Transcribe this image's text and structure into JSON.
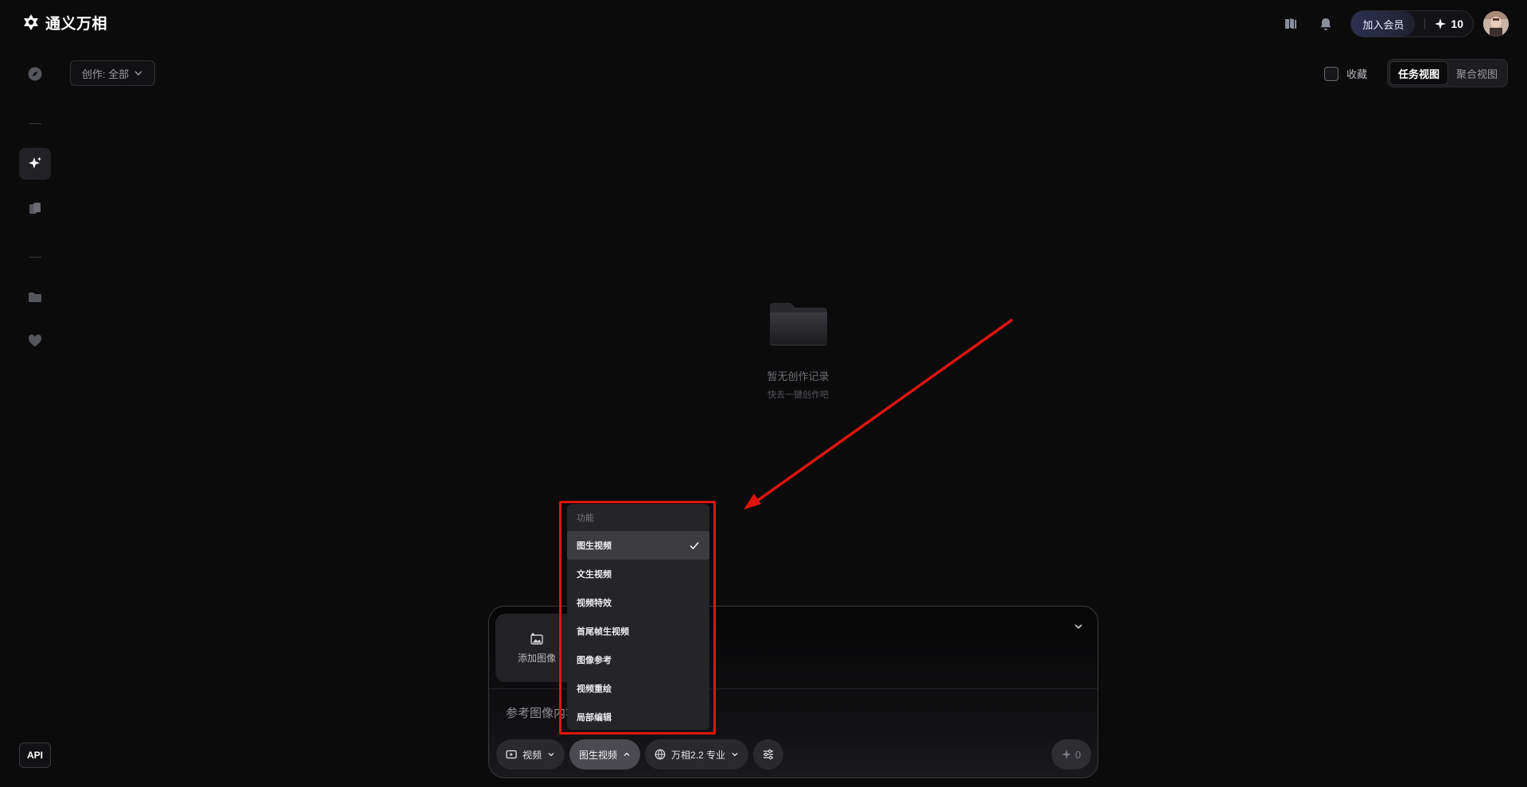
{
  "app": {
    "name": "通义万相"
  },
  "header": {
    "icons": [
      "docs-icon",
      "bell-icon"
    ],
    "member_button": "加入会员",
    "credits": "10"
  },
  "sidebar": {
    "items": [
      {
        "name": "explore",
        "icon": "compass-icon"
      },
      {
        "name": "create",
        "icon": "sparkle-icon",
        "active": true
      },
      {
        "name": "gallery",
        "icon": "stack-icon"
      },
      {
        "name": "folder",
        "icon": "folder-icon"
      },
      {
        "name": "favorites",
        "icon": "heart-icon"
      }
    ],
    "api_label": "API"
  },
  "filter": {
    "label": "创作: 全部"
  },
  "favorites": {
    "label": "收藏",
    "checked": false
  },
  "view_toggle": {
    "tabs": [
      {
        "label": "任务视图",
        "active": true
      },
      {
        "label": "聚合视图",
        "active": false
      }
    ]
  },
  "empty_state": {
    "title": "暂无创作记录",
    "subtitle": "快去一键创作吧"
  },
  "composer": {
    "add_image": "添加图像",
    "placeholder": "参考图像内容",
    "chips": {
      "type": "视频",
      "mode": "图生视频",
      "model": "万相2.2 专业"
    },
    "send_count": "0"
  },
  "dropdown": {
    "section": "功能",
    "items": [
      {
        "label": "图生视频",
        "selected": true
      },
      {
        "label": "文生视频",
        "selected": false
      },
      {
        "label": "视频特效",
        "selected": false
      },
      {
        "label": "首尾帧生视频",
        "selected": false
      },
      {
        "label": "图像参考",
        "selected": false
      },
      {
        "label": "视频重绘",
        "selected": false
      },
      {
        "label": "局部编辑",
        "selected": false
      }
    ]
  },
  "colors": {
    "background": "#0b0b0c",
    "annotation_red": "#e0140f",
    "member_gradient": "#2c3050"
  }
}
